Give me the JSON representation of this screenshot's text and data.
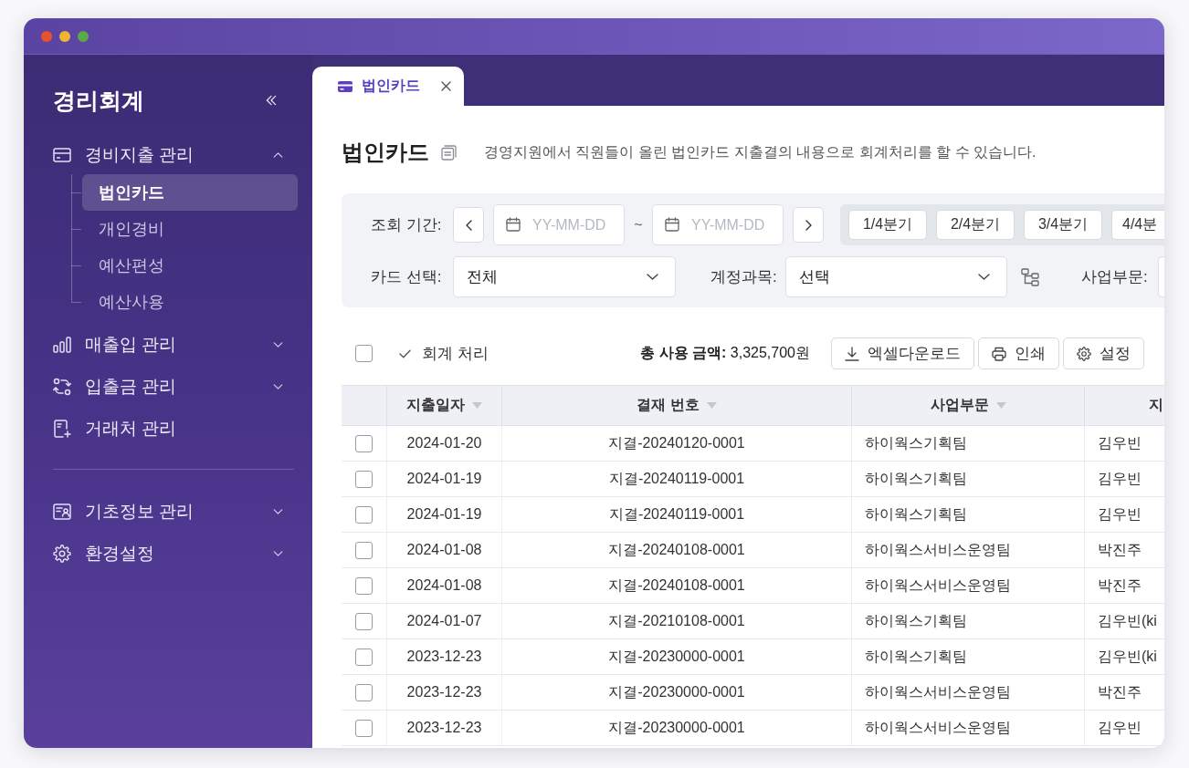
{
  "sidebar": {
    "title": "경리회계",
    "sections": [
      {
        "items": [
          {
            "kind": "group",
            "label": "경비지출 관리",
            "expanded": true,
            "children": [
              {
                "label": "법인카드",
                "selected": true
              },
              {
                "label": "개인경비",
                "selected": false
              },
              {
                "label": "예산편성",
                "selected": false
              },
              {
                "label": "예산사용",
                "selected": false
              }
            ]
          },
          {
            "kind": "group",
            "label": "매출입 관리",
            "expanded": false
          },
          {
            "kind": "group",
            "label": "입출금 관리",
            "expanded": false
          },
          {
            "kind": "link",
            "label": "거래처 관리"
          }
        ]
      },
      {
        "items": [
          {
            "kind": "group",
            "label": "기초정보 관리",
            "expanded": false
          },
          {
            "kind": "group",
            "label": "환경설정",
            "expanded": false
          }
        ]
      }
    ]
  },
  "tabs": [
    {
      "label": "법인카드",
      "selected": true
    }
  ],
  "page": {
    "title": "법인카드",
    "description": "경영지원에서 직원들이 올린 법인카드 지출결의 내용으로 회계처리를 할 수 있습니다."
  },
  "filters": {
    "period": {
      "label": "조회 기간:",
      "start": {
        "placeholder": "YY-MM-DD"
      },
      "separator": "~",
      "end": {
        "placeholder": "YY-MM-DD"
      },
      "quarters": [
        "1/4분기",
        "2/4분기",
        "3/4분기",
        "4/4분"
      ]
    },
    "card": {
      "label": "카드 선택:",
      "value": "전체"
    },
    "account": {
      "label": "계정과목:",
      "value": "선택"
    },
    "business_unit": {
      "label": "사업부문:"
    }
  },
  "toolbar": {
    "select_all": {
      "checked": false
    },
    "process_button": "회계 처리",
    "total": "**총 사용 금액:** 3,325,700원",
    "buttons": [
      "엑셀다운로드",
      "인쇄",
      "설정"
    ]
  },
  "table": {
    "columns": [
      {
        "label": "지출일자",
        "sortable": true
      },
      {
        "label": "결재 번호",
        "sortable": true
      },
      {
        "label": "사업부문",
        "sortable": true
      },
      {
        "label": "지",
        "sortable": false
      }
    ],
    "rows": [
      {
        "checked": false,
        "cells": [
          "2024-01-20",
          "지결-20240120-0001",
          "하이웍스기획팀",
          "김우빈"
        ]
      },
      {
        "checked": false,
        "cells": [
          "2024-01-19",
          "지결-20240119-0001",
          "하이웍스기획팀",
          "김우빈"
        ]
      },
      {
        "checked": false,
        "cells": [
          "2024-01-19",
          "지결-20240119-0001",
          "하이웍스기획팀",
          "김우빈"
        ]
      },
      {
        "checked": false,
        "cells": [
          "2024-01-08",
          "지결-20240108-0001",
          "하이웍스서비스운영팀",
          "박진주"
        ]
      },
      {
        "checked": false,
        "cells": [
          "2024-01-08",
          "지결-20240108-0001",
          "하이웍스서비스운영팀",
          "박진주"
        ]
      },
      {
        "checked": false,
        "cells": [
          "2024-01-07",
          "지결-20210108-0001",
          "하이웍스기획팀",
          "김우빈(ki"
        ]
      },
      {
        "checked": false,
        "cells": [
          "2023-12-23",
          "지결-20230000-0001",
          "하이웍스기획팀",
          "김우빈(ki"
        ]
      },
      {
        "checked": false,
        "cells": [
          "2023-12-23",
          "지결-20230000-0001",
          "하이웍스서비스운영팀",
          "박진주"
        ]
      },
      {
        "checked": false,
        "cells": [
          "2023-12-23",
          "지결-20230000-0001",
          "하이웍스서비스운영팀",
          "김우빈"
        ]
      }
    ]
  }
}
